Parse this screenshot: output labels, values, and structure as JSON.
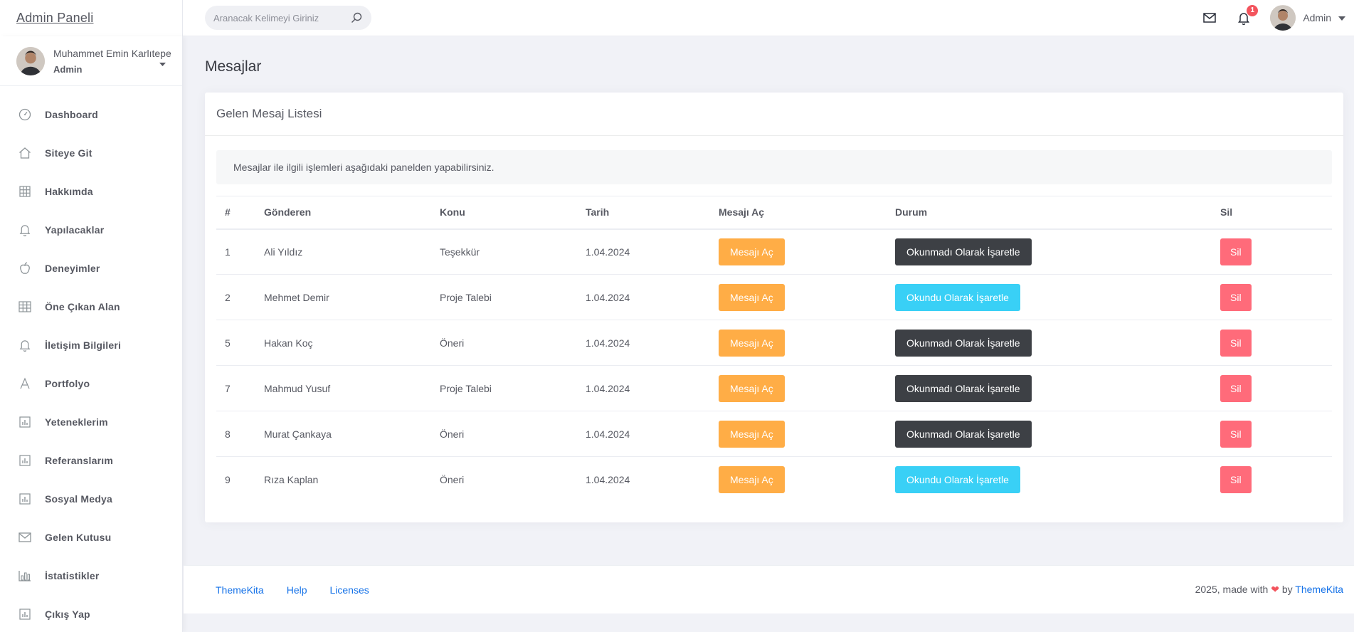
{
  "brand": {
    "title": "Admin Paneli"
  },
  "header": {
    "search_placeholder": "Aranacak Kelimeyi Giriniz",
    "notification_count": "1",
    "user_name": "Admin"
  },
  "sidebar": {
    "user": {
      "name": "Muhammet Emin Karlıtepe",
      "role": "Admin"
    },
    "items": [
      {
        "label": "Dashboard",
        "icon": "dashboard-icon"
      },
      {
        "label": "Siteye Git",
        "icon": "home-icon"
      },
      {
        "label": "Hakkımda",
        "icon": "grid-icon"
      },
      {
        "label": "Yapılacaklar",
        "icon": "bell-icon"
      },
      {
        "label": "Deneyimler",
        "icon": "apple-icon"
      },
      {
        "label": "Öne Çıkan Alan",
        "icon": "table-icon"
      },
      {
        "label": "İletişim Bilgileri",
        "icon": "bell-icon"
      },
      {
        "label": "Portfolyo",
        "icon": "font-icon"
      },
      {
        "label": "Yeteneklerim",
        "icon": "chart-box-icon"
      },
      {
        "label": "Referanslarım",
        "icon": "chart-box-icon"
      },
      {
        "label": "Sosyal Medya",
        "icon": "chart-box-icon"
      },
      {
        "label": "Gelen Kutusu",
        "icon": "envelope-icon"
      },
      {
        "label": "İstatistikler",
        "icon": "bar-chart-icon"
      },
      {
        "label": "Çıkış Yap",
        "icon": "chart-box-icon"
      }
    ]
  },
  "main": {
    "page_title": "Mesajlar",
    "card_title": "Gelen Mesaj Listesi",
    "info_text": "Mesajlar ile ilgili işlemleri aşağıdaki panelden yapabilirsiniz.",
    "table": {
      "headers": [
        "#",
        "Gönderen",
        "Konu",
        "Tarih",
        "Mesajı Aç",
        "Durum",
        "Sil"
      ],
      "rows": [
        {
          "id": "1",
          "sender": "Ali Yıldız",
          "subject": "Teşekkür",
          "date": "1.04.2024",
          "open": "Mesajı Aç",
          "status": "Okunmadı Olarak İşaretle",
          "status_style": "dark",
          "delete": "Sil"
        },
        {
          "id": "2",
          "sender": "Mehmet Demir",
          "subject": "Proje Talebi",
          "date": "1.04.2024",
          "open": "Mesajı Aç",
          "status": "Okundu Olarak İşaretle",
          "status_style": "info",
          "delete": "Sil"
        },
        {
          "id": "5",
          "sender": "Hakan Koç",
          "subject": "Öneri",
          "date": "1.04.2024",
          "open": "Mesajı Aç",
          "status": "Okunmadı Olarak İşaretle",
          "status_style": "dark",
          "delete": "Sil"
        },
        {
          "id": "7",
          "sender": "Mahmud Yusuf",
          "subject": "Proje Talebi",
          "date": "1.04.2024",
          "open": "Mesajı Aç",
          "status": "Okunmadı Olarak İşaretle",
          "status_style": "dark",
          "delete": "Sil"
        },
        {
          "id": "8",
          "sender": "Murat Çankaya",
          "subject": "Öneri",
          "date": "1.04.2024",
          "open": "Mesajı Aç",
          "status": "Okunmadı Olarak İşaretle",
          "status_style": "dark",
          "delete": "Sil"
        },
        {
          "id": "9",
          "sender": "Rıza Kaplan",
          "subject": "Öneri",
          "date": "1.04.2024",
          "open": "Mesajı Aç",
          "status": "Okundu Olarak İşaretle",
          "status_style": "info",
          "delete": "Sil"
        }
      ]
    }
  },
  "footer": {
    "links": [
      "ThemeKita",
      "Help",
      "Licenses"
    ],
    "copy_prefix": "2025, made with",
    "copy_by": "by",
    "copy_link": "ThemeKita"
  },
  "colors": {
    "warning": "#ffad46",
    "dark": "#3d4045",
    "info": "#39d0f6",
    "danger": "#ff6b7a",
    "link": "#1572e8"
  }
}
